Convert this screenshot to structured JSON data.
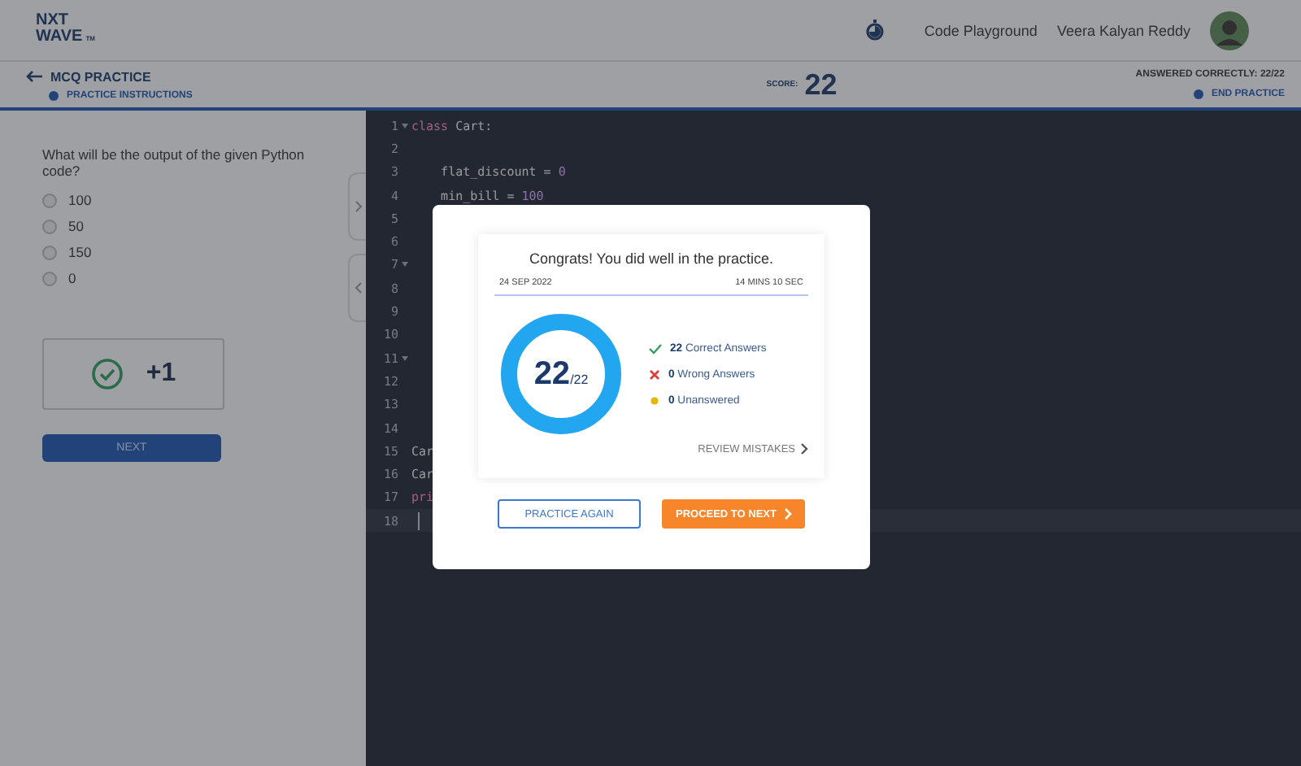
{
  "header": {
    "logo_top": "NXT",
    "logo_bottom": "WAVE",
    "logo_suffix": "TM",
    "links": [
      "Code Playground"
    ],
    "user_name": "Veera Kalyan Reddy"
  },
  "subheader": {
    "title": "MCQ PRACTICE",
    "instructions": "PRACTICE INSTRUCTIONS",
    "score_label": "SCORE:",
    "score": "22",
    "answered": "ANSWERED CORRECTLY: 22/22",
    "end": "END PRACTICE"
  },
  "question": {
    "text": "What will be the output of the given Python code?",
    "options": [
      {
        "label": "100",
        "selected": false
      },
      {
        "label": "50",
        "selected": false
      },
      {
        "label": "150",
        "selected": false
      },
      {
        "label": "0",
        "selected": false
      }
    ],
    "result": "+1",
    "next": "NEXT"
  },
  "editor": {
    "lines": [
      {
        "num": "1",
        "fold": true,
        "active": false,
        "code": [
          {
            "t": "class",
            "kind": "keyword"
          },
          {
            "t": " Cart:",
            "kind": "plain"
          }
        ]
      },
      {
        "num": "2",
        "fold": false,
        "active": false
      },
      {
        "num": "3",
        "fold": false,
        "active": false,
        "code": [
          {
            "t": "    flat_discount = ",
            "kind": "plain"
          },
          {
            "t": "0",
            "kind": "number"
          }
        ]
      },
      {
        "num": "4",
        "fold": false,
        "active": false,
        "code": [
          {
            "t": "    min_bill = ",
            "kind": "plain"
          },
          {
            "t": "100",
            "kind": "number"
          }
        ]
      },
      {
        "num": "5",
        "fold": false,
        "active": false
      },
      {
        "num": "6",
        "fold": false,
        "active": false
      },
      {
        "num": "7",
        "fold": true,
        "active": false
      },
      {
        "num": "8",
        "fold": false,
        "active": false
      },
      {
        "num": "9",
        "fold": false,
        "active": false
      },
      {
        "num": "10",
        "fold": false,
        "active": false
      },
      {
        "num": "11",
        "fold": true,
        "active": false
      },
      {
        "num": "12",
        "fold": false,
        "active": false
      },
      {
        "num": "13",
        "fold": false,
        "active": false
      },
      {
        "num": "14",
        "fold": false,
        "active": false
      },
      {
        "num": "15",
        "fold": false,
        "active": false,
        "code": [
          {
            "t": "Car",
            "kind": "plain"
          }
        ]
      },
      {
        "num": "16",
        "fold": false,
        "active": false,
        "code": [
          {
            "t": "Car",
            "kind": "plain"
          }
        ]
      },
      {
        "num": "17",
        "fold": false,
        "active": false,
        "code": [
          {
            "t": "pri",
            "kind": "keyword"
          }
        ]
      },
      {
        "num": "18",
        "fold": false,
        "active": true
      }
    ]
  },
  "modal": {
    "title": "Congrats! You did well in the practice.",
    "date": "24 SEP 2022",
    "duration": "14 MINS 10 SEC",
    "score": "22",
    "total": "/22",
    "stats": [
      {
        "kind": "correct",
        "count": "22",
        "label": "Correct Answers"
      },
      {
        "kind": "wrong",
        "count": "0",
        "label": "Wrong Answers"
      },
      {
        "kind": "unanswered",
        "count": "0",
        "label": "Unanswered"
      }
    ],
    "review": "REVIEW MISTAKES",
    "practice_again": "PRACTICE AGAIN",
    "proceed": "PROCEED TO NEXT"
  }
}
